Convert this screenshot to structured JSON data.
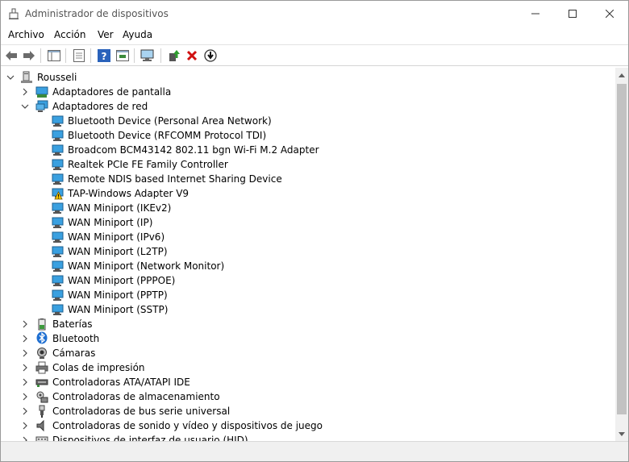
{
  "window": {
    "title": "Administrador de dispositivos"
  },
  "menu": [
    "Archivo",
    "Acción",
    "Ver",
    "Ayuda"
  ],
  "tree": {
    "root": "Rousseli",
    "display_adapters": "Adaptadores de pantalla",
    "network_adapters": {
      "label": "Adaptadores de red",
      "items": [
        "Bluetooth Device (Personal Area Network)",
        "Bluetooth Device (RFCOMM Protocol TDI)",
        "Broadcom BCM43142 802.11 bgn Wi-Fi M.2 Adapter",
        "Realtek PCIe FE Family Controller",
        "Remote NDIS based Internet Sharing Device",
        "TAP-Windows Adapter V9",
        "WAN Miniport (IKEv2)",
        "WAN Miniport (IP)",
        "WAN Miniport (IPv6)",
        "WAN Miniport (L2TP)",
        "WAN Miniport (Network Monitor)",
        "WAN Miniport (PPPOE)",
        "WAN Miniport (PPTP)",
        "WAN Miniport (SSTP)"
      ]
    },
    "categories": [
      "Baterías",
      "Bluetooth",
      "Cámaras",
      "Colas de impresión",
      "Controladoras ATA/ATAPI IDE",
      "Controladoras de almacenamiento",
      "Controladoras de bus serie universal",
      "Controladoras de sonido y vídeo y dispositivos de juego",
      "Dispositivos de interfaz de usuario (HID)"
    ]
  },
  "colors": {
    "accent": "#1e73be",
    "close_red": "#e81123",
    "monitor_blue": "#3aa0e0",
    "warning_yellow": "#f4c400"
  }
}
